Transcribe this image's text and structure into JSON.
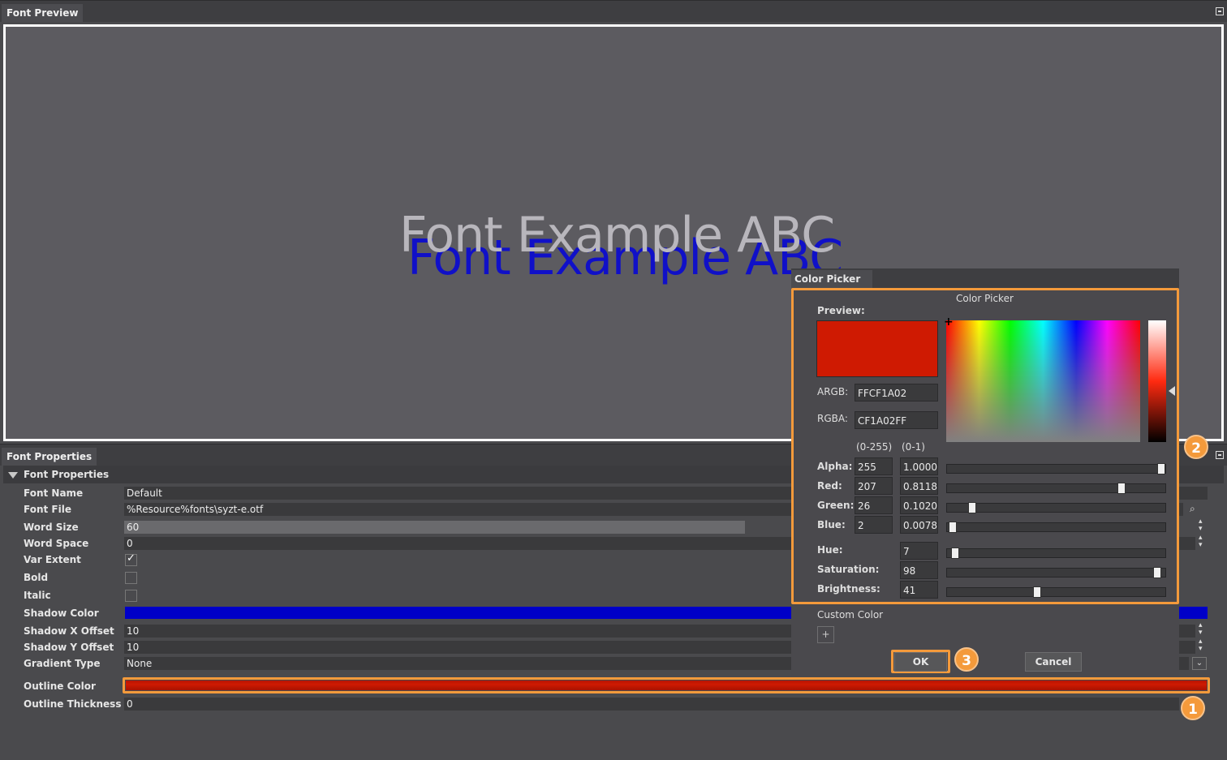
{
  "font_preview": {
    "tab_label": "Font Preview",
    "sample_text": "Font Example ABC"
  },
  "font_properties": {
    "tab_label": "Font Properties",
    "group_label": "Font Properties",
    "rows": {
      "font_name": {
        "label": "Font Name",
        "value": "Default"
      },
      "font_file": {
        "label": "Font File",
        "value": "%Resource%fonts\\syzt-e.otf"
      },
      "word_size": {
        "label": "Word Size",
        "value": "60"
      },
      "word_space": {
        "label": "Word Space",
        "value": "0"
      },
      "var_extent": {
        "label": "Var Extent",
        "checked": true
      },
      "bold": {
        "label": "Bold",
        "checked": false
      },
      "italic": {
        "label": "Italic",
        "checked": false
      },
      "shadow_color": {
        "label": "Shadow Color",
        "color": "#0000c8"
      },
      "shadow_x": {
        "label": "Shadow X Offset",
        "value": "10"
      },
      "shadow_y": {
        "label": "Shadow Y Offset",
        "value": "10"
      },
      "gradient_type": {
        "label": "Gradient Type",
        "value": "None"
      },
      "outline_color": {
        "label": "Outline Color",
        "color": "#cf1a02"
      },
      "outline_thickness": {
        "label": "Outline Thickness",
        "value": "0"
      }
    }
  },
  "color_picker": {
    "window_title": "Color Picker",
    "heading": "Color Picker",
    "preview_label": "Preview:",
    "preview_color": "#cf1a02",
    "argb_label": "ARGB:",
    "argb_value": "FFCF1A02",
    "rgba_label": "RGBA:",
    "rgba_value": "CF1A02FF",
    "col_255": "(0-255)",
    "col_01": "(0-1)",
    "alpha": {
      "label": "Alpha:",
      "v255": "255",
      "v01": "1.0000",
      "fraction": 1.0
    },
    "red": {
      "label": "Red:",
      "v255": "207",
      "v01": "0.8118",
      "fraction": 0.8118
    },
    "green": {
      "label": "Green:",
      "v255": "26",
      "v01": "0.1020",
      "fraction": 0.102
    },
    "blue": {
      "label": "Blue:",
      "v255": "2",
      "v01": "0.0078",
      "fraction": 0.0078
    },
    "hue": {
      "label": "Hue:",
      "value": "7",
      "fraction": 0.02
    },
    "saturation": {
      "label": "Saturation:",
      "value": "98",
      "fraction": 0.98
    },
    "brightness": {
      "label": "Brightness:",
      "value": "41",
      "fraction": 0.41
    },
    "custom_color_label": "Custom Color",
    "add_custom": "+",
    "ok_label": "OK",
    "cancel_label": "Cancel"
  },
  "badges": [
    "1",
    "2",
    "3"
  ],
  "colors": {
    "accent": "#f49a3b"
  }
}
